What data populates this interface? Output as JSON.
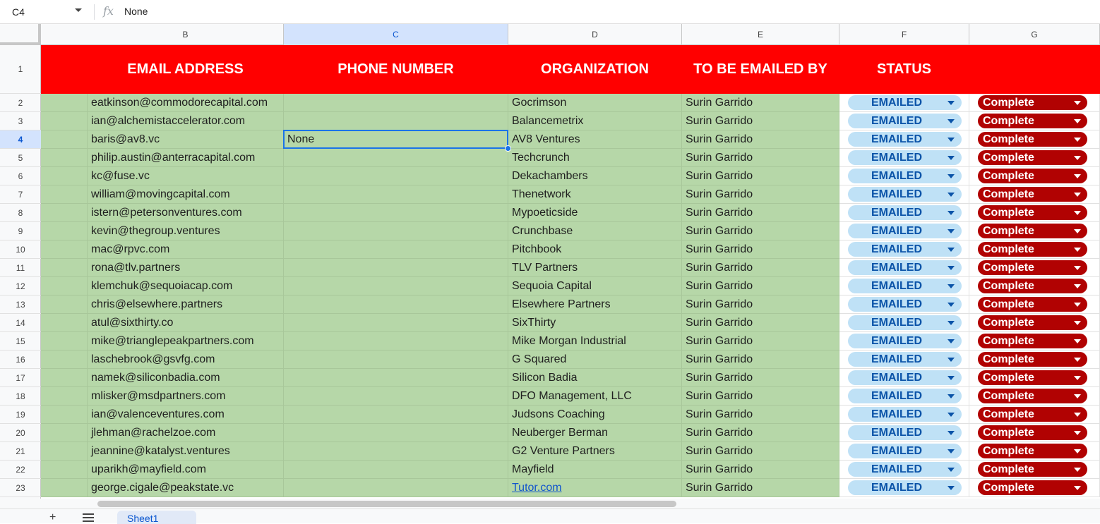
{
  "formula_bar": {
    "cell_ref": "C4",
    "fx": "fx",
    "value": "None"
  },
  "columns": [
    "B",
    "C",
    "D",
    "E",
    "F",
    "G"
  ],
  "header_row": {
    "row_number": "1",
    "cells": [
      "EMAIL ADDRESS",
      "PHONE NUMBER",
      "ORGANIZATION",
      "TO BE EMAILED BY",
      "STATUS",
      ""
    ]
  },
  "colors": {
    "header_bg": "#ff0000",
    "row_bg": "#b6d7a8",
    "emailed_chip": "#bfe1f6",
    "complete_chip": "#b10202",
    "selection": "#1a73e8"
  },
  "rows": [
    {
      "n": "2",
      "email": "eatkinson@commodorecapital.com",
      "phone": "",
      "org": "Gocrimson",
      "by": "Surin Garrido",
      "status": "EMAILED",
      "state": "Complete"
    },
    {
      "n": "3",
      "email": "ian@alchemistaccelerator.com",
      "phone": "",
      "org": "Balancemetrix",
      "by": "Surin Garrido",
      "status": "EMAILED",
      "state": "Complete"
    },
    {
      "n": "4",
      "email": "baris@av8.vc",
      "phone": "None",
      "org": "AV8 Ventures",
      "by": "Surin Garrido",
      "status": "EMAILED",
      "state": "Complete"
    },
    {
      "n": "5",
      "email": "philip.austin@anterracapital.com",
      "phone": "",
      "org": "Techcrunch",
      "by": "Surin Garrido",
      "status": "EMAILED",
      "state": "Complete"
    },
    {
      "n": "6",
      "email": "kc@fuse.vc",
      "phone": "",
      "org": "Dekachambers",
      "by": "Surin Garrido",
      "status": "EMAILED",
      "state": "Complete"
    },
    {
      "n": "7",
      "email": "william@movingcapital.com",
      "phone": "",
      "org": "Thenetwork",
      "by": "Surin Garrido",
      "status": "EMAILED",
      "state": "Complete"
    },
    {
      "n": "8",
      "email": "istern@petersonventures.com",
      "phone": "",
      "org": "Mypoeticside",
      "by": "Surin Garrido",
      "status": "EMAILED",
      "state": "Complete"
    },
    {
      "n": "9",
      "email": "kevin@thegroup.ventures",
      "phone": "",
      "org": "Crunchbase",
      "by": "Surin Garrido",
      "status": "EMAILED",
      "state": "Complete"
    },
    {
      "n": "10",
      "email": "mac@rpvc.com",
      "phone": "",
      "org": "Pitchbook",
      "by": "Surin Garrido",
      "status": "EMAILED",
      "state": "Complete"
    },
    {
      "n": "11",
      "email": "rona@tlv.partners",
      "phone": "",
      "org": "TLV Partners",
      "by": "Surin Garrido",
      "status": "EMAILED",
      "state": "Complete"
    },
    {
      "n": "12",
      "email": "klemchuk@sequoiacap.com",
      "phone": "",
      "org": "Sequoia Capital",
      "by": "Surin Garrido",
      "status": "EMAILED",
      "state": "Complete"
    },
    {
      "n": "13",
      "email": "chris@elsewhere.partners",
      "phone": "",
      "org": "Elsewhere Partners",
      "by": "Surin Garrido",
      "status": "EMAILED",
      "state": "Complete"
    },
    {
      "n": "14",
      "email": "atul@sixthirty.co",
      "phone": "",
      "org": "SixThirty",
      "by": "Surin Garrido",
      "status": "EMAILED",
      "state": "Complete"
    },
    {
      "n": "15",
      "email": "mike@trianglepeakpartners.com",
      "phone": "",
      "org": "Mike Morgan Industrial",
      "by": "Surin Garrido",
      "status": "EMAILED",
      "state": "Complete"
    },
    {
      "n": "16",
      "email": "laschebrook@gsvfg.com",
      "phone": "",
      "org": "G Squared",
      "by": "Surin Garrido",
      "status": "EMAILED",
      "state": "Complete"
    },
    {
      "n": "17",
      "email": "namek@siliconbadia.com",
      "phone": "",
      "org": "Silicon Badia",
      "by": "Surin Garrido",
      "status": "EMAILED",
      "state": "Complete"
    },
    {
      "n": "18",
      "email": "mlisker@msdpartners.com",
      "phone": "",
      "org": "DFO Management, LLC",
      "by": "Surin Garrido",
      "status": "EMAILED",
      "state": "Complete"
    },
    {
      "n": "19",
      "email": "ian@valenceventures.com",
      "phone": "",
      "org": "Judsons Coaching",
      "by": "Surin Garrido",
      "status": "EMAILED",
      "state": "Complete"
    },
    {
      "n": "20",
      "email": "jlehman@rachelzoe.com",
      "phone": "",
      "org": "Neuberger Berman",
      "by": "Surin Garrido",
      "status": "EMAILED",
      "state": "Complete"
    },
    {
      "n": "21",
      "email": "jeannine@katalyst.ventures",
      "phone": "",
      "org": "G2 Venture Partners",
      "by": "Surin Garrido",
      "status": "EMAILED",
      "state": "Complete"
    },
    {
      "n": "22",
      "email": "uparikh@mayfield.com",
      "phone": "",
      "org": "Mayfield",
      "by": "Surin Garrido",
      "status": "EMAILED",
      "state": "Complete"
    },
    {
      "n": "23",
      "email": "george.cigale@peakstate.vc",
      "phone": "",
      "org": "Tutor.com",
      "org_is_link": true,
      "by": "Surin Garrido",
      "status": "EMAILED",
      "state": "Complete"
    }
  ],
  "selected": {
    "row": "4",
    "column": "C"
  },
  "sheet_tabs": {
    "add": "+",
    "active": "Sheet1"
  }
}
